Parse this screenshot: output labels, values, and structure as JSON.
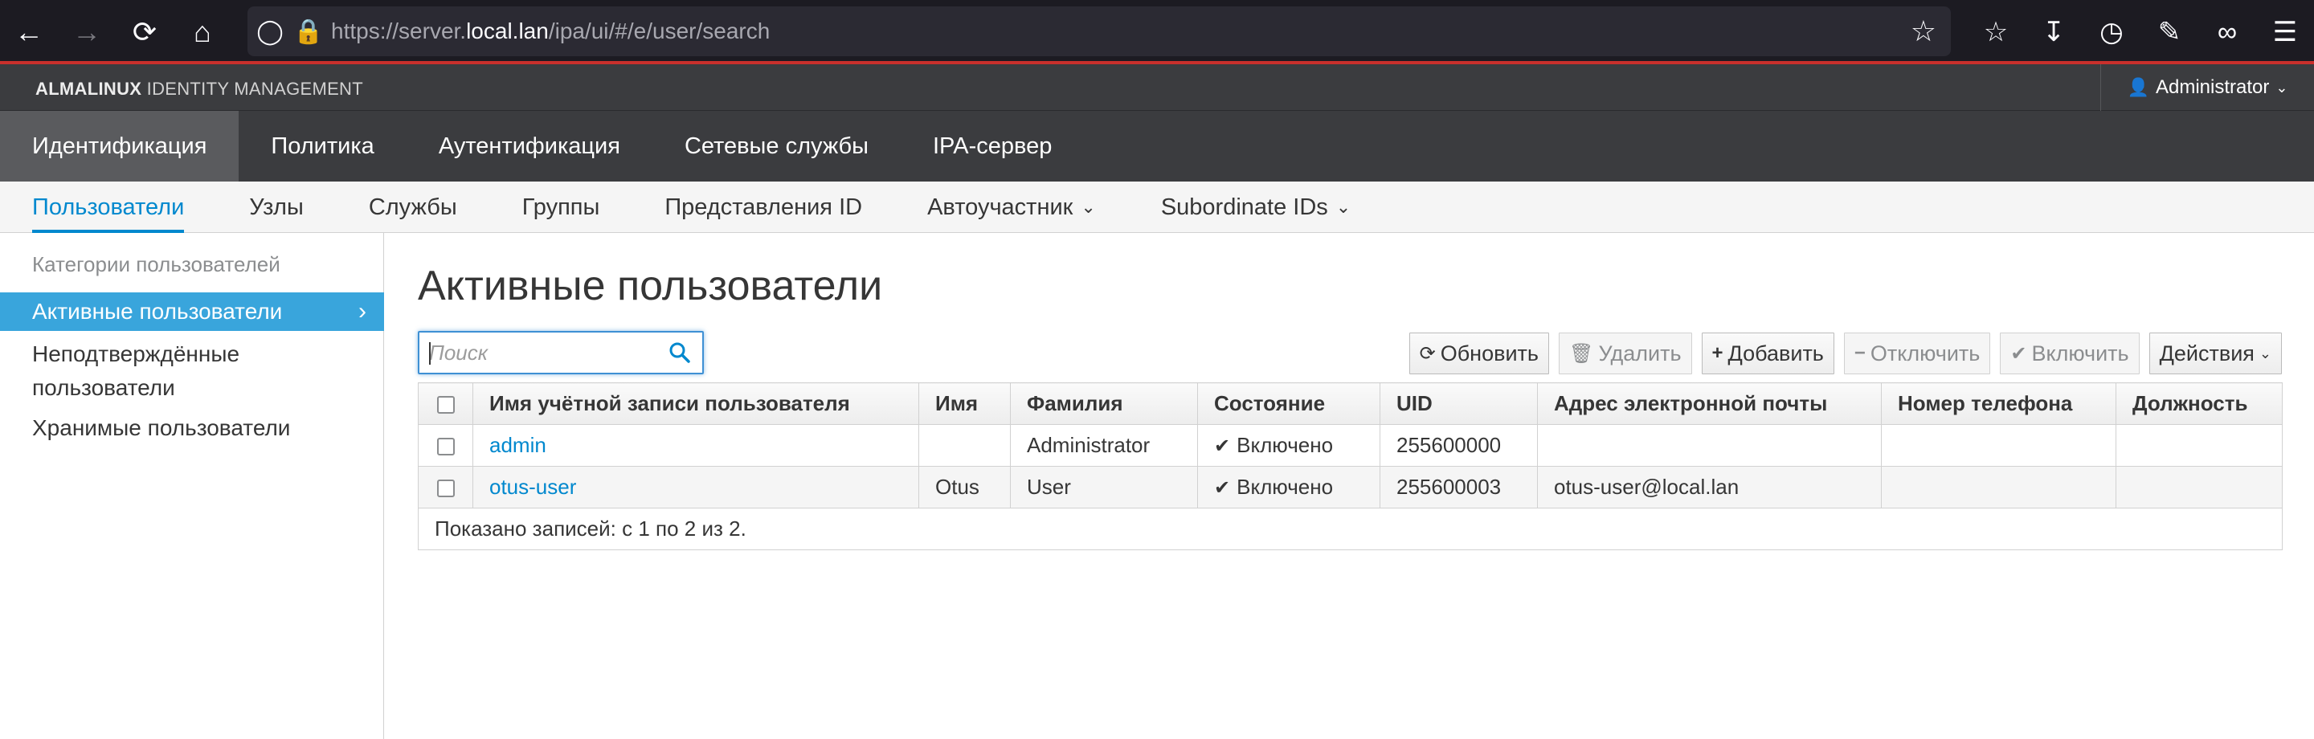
{
  "browser": {
    "url_prefix": "https://server.",
    "url_host": "local.lan",
    "url_path": "/ipa/ui/#/e/user/search",
    "icons": [
      "back-icon",
      "forward-icon",
      "reload-icon",
      "home-icon",
      "shield-icon",
      "lock-icon",
      "star-icon",
      "pocket-icon",
      "download-icon",
      "history-icon",
      "extensions-icon",
      "mask-icon",
      "menu-icon"
    ]
  },
  "masthead": {
    "brand_bold": "ALMALINUX",
    "brand_rest": " IDENTITY MANAGEMENT",
    "user": "Administrator"
  },
  "primary_nav": [
    {
      "label": "Идентификация",
      "active": true
    },
    {
      "label": "Политика",
      "active": false
    },
    {
      "label": "Аутентификация",
      "active": false
    },
    {
      "label": "Сетевые службы",
      "active": false
    },
    {
      "label": "IPA-сервер",
      "active": false
    }
  ],
  "secondary_nav": [
    {
      "label": "Пользователи",
      "active": true
    },
    {
      "label": "Узлы"
    },
    {
      "label": "Службы"
    },
    {
      "label": "Группы"
    },
    {
      "label": "Представления ID"
    },
    {
      "label": "Автоучастник",
      "dropdown": true
    },
    {
      "label": "Subordinate IDs",
      "dropdown": true
    }
  ],
  "sidebar": {
    "category_title": "Категории пользователей",
    "items": [
      {
        "label": "Активные пользователи",
        "active": true
      },
      {
        "label_line1": "Неподтверждённые",
        "label_line2": "пользователи"
      },
      {
        "label": "Хранимые пользователи"
      }
    ]
  },
  "main": {
    "title": "Активные пользователи",
    "search_placeholder": "Поиск",
    "toolbar": {
      "refresh": "Обновить",
      "delete": "Удалить",
      "add": "Добавить",
      "disable": "Отключить",
      "enable": "Включить",
      "actions": "Действия"
    },
    "columns": [
      "Имя учётной записи пользователя",
      "Имя",
      "Фамилия",
      "Состояние",
      "UID",
      "Адрес электронной почты",
      "Номер телефона",
      "Должность"
    ],
    "rows": [
      {
        "login": "admin",
        "first": "",
        "last": "Administrator",
        "status": "Включено",
        "uid": "255600000",
        "email": "",
        "phone": "",
        "title": ""
      },
      {
        "login": "otus-user",
        "first": "Otus",
        "last": "User",
        "status": "Включено",
        "uid": "255600003",
        "email": "otus-user@local.lan",
        "phone": "",
        "title": ""
      }
    ],
    "footer": "Показано записей: с 1 по 2 из 2."
  },
  "colors": {
    "accent": "#0088ce",
    "sidebar_active": "#39a5dc",
    "masthead": "#3b3c3f",
    "browser": "#1c1b22"
  }
}
